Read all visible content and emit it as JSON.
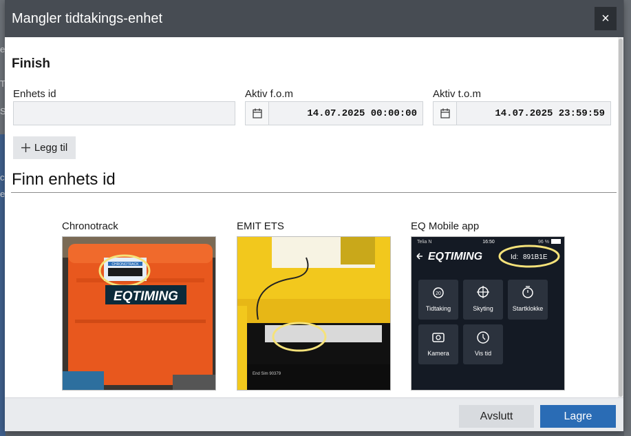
{
  "background": {
    "left_texts": [
      "e",
      "T",
      "S",
      "c",
      "e"
    ]
  },
  "dialog": {
    "title": "Mangler tidtakings-enhet",
    "close_label": "×"
  },
  "form": {
    "section_title": "Finish",
    "unit_id_label": "Enhets id",
    "unit_id_value": "",
    "active_from_label": "Aktiv f.o.m",
    "active_from_value": "14.07.2025 00:00:00",
    "active_to_label": "Aktiv t.o.m",
    "active_to_value": "14.07.2025 23:59:59",
    "add_button_label": "Legg til"
  },
  "find_section": {
    "heading": "Finn enhets id",
    "devices": [
      {
        "name": "Chronotrack",
        "photo_text": "EQTIMING",
        "sticker_text": "CHRONOTRACK"
      },
      {
        "name": "EMIT ETS",
        "photo_text": "End Sim 90379"
      },
      {
        "name": "EQ Mobile app",
        "status_left": "Telia N",
        "status_time": "16:50",
        "status_battery": "96 %",
        "app_logo": "EQTIMING",
        "id_label": "Id:",
        "id_value": "891B1E",
        "tiles": [
          {
            "label": "Tidtaking",
            "icon": "stopwatch-20-icon"
          },
          {
            "label": "Skyting",
            "icon": "crosshair-icon"
          },
          {
            "label": "Startklokke",
            "icon": "timer-icon"
          },
          {
            "label": "Kamera",
            "icon": "camera-icon"
          },
          {
            "label": "Vis tid",
            "icon": "clock-icon"
          }
        ]
      }
    ]
  },
  "footer": {
    "cancel_label": "Avslutt",
    "save_label": "Lagre"
  },
  "colors": {
    "header_bg": "#474c53",
    "primary_button": "#2a6cb5",
    "highlight_ring": "#f5e27a",
    "case_orange": "#e8581e",
    "case_yellow": "#f2c81d"
  }
}
